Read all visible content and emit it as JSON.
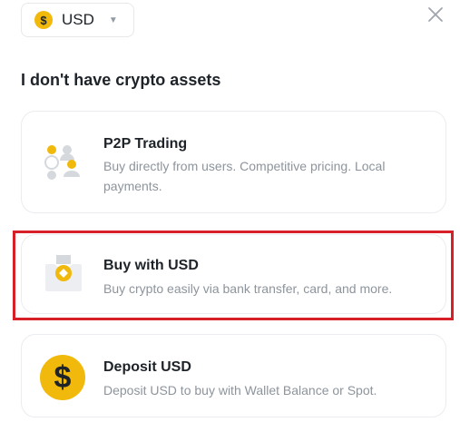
{
  "currency": {
    "symbol": "$",
    "label": "USD",
    "icon": "dollar-coin-icon"
  },
  "close_icon": "close-icon",
  "section_title": "I don't have crypto assets",
  "options": [
    {
      "title": "P2P Trading",
      "description": "Buy directly from users. Competitive pricing. Local payments.",
      "icon": "p2p-users-icon"
    },
    {
      "title": "Buy with USD",
      "description": "Buy crypto easily via bank transfer, card, and more.",
      "icon": "bank-transfer-icon"
    },
    {
      "title": "Deposit USD",
      "description": "Deposit USD to buy with Wallet Balance or Spot.",
      "icon": "dollar-coin-icon",
      "icon_symbol": "$"
    }
  ],
  "colors": {
    "accent": "#F0B90B",
    "highlight": "#D61F26",
    "text_primary": "#1E2329",
    "text_secondary": "#8D949C"
  }
}
